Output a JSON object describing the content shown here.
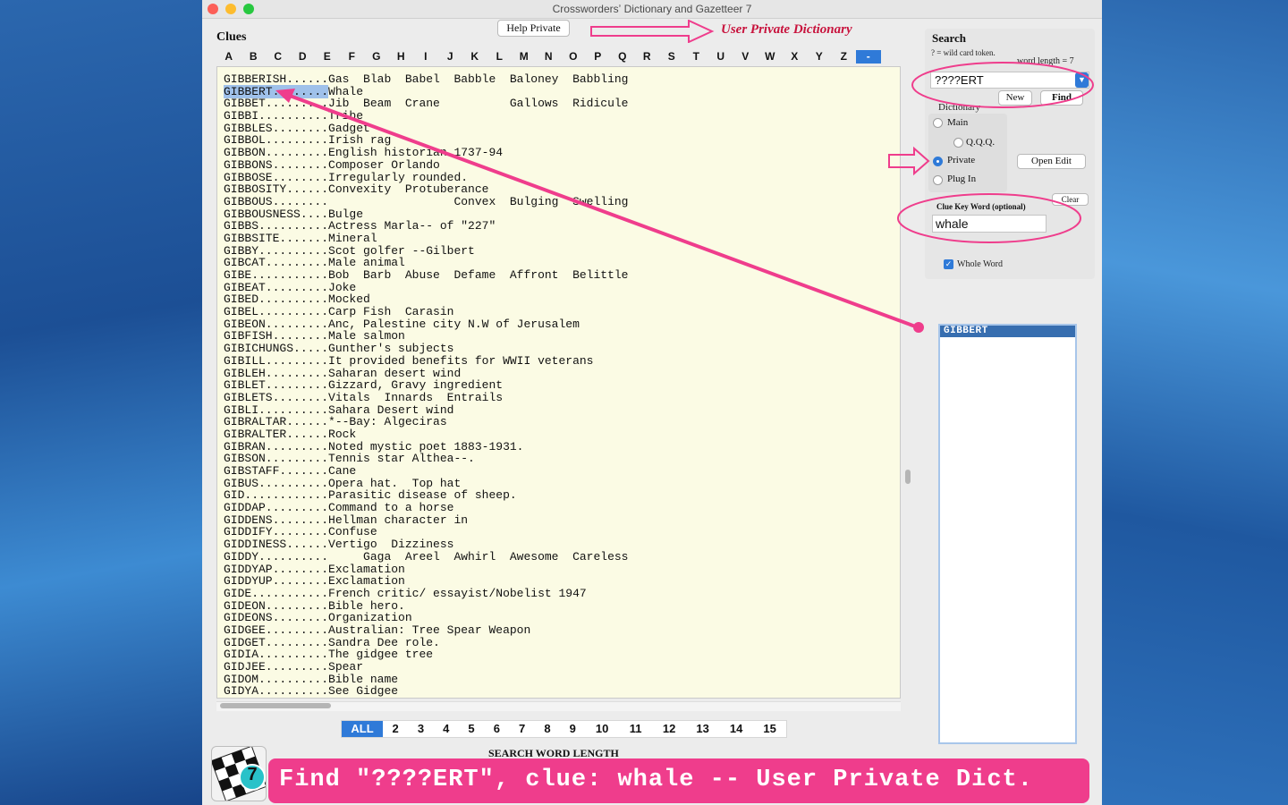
{
  "window": {
    "title": "Crosswordersʼ Dictionary and Gazetteer 7"
  },
  "clues_label": "Clues",
  "help_button": "Help Private",
  "annotation_title": "User Private Dictionary",
  "letters": [
    "A",
    "B",
    "C",
    "D",
    "E",
    "F",
    "G",
    "H",
    "I",
    "J",
    "K",
    "L",
    "M",
    "N",
    "O",
    "P",
    "Q",
    "R",
    "S",
    "T",
    "U",
    "V",
    "W",
    "X",
    "Y",
    "Z",
    "-"
  ],
  "active_letter": "-",
  "rows": [
    {
      "word": "GIBBERISH......",
      "clue": "Gas  Blab  Babel  Babble  Baloney  Babbling",
      "hl": false
    },
    {
      "word": "GIBBERT........",
      "clue": "Whale",
      "hl": true
    },
    {
      "word": "GIBBET.........",
      "clue": "Jib  Beam  Crane          Gallows  Ridicule",
      "hl": false
    },
    {
      "word": "GIBBI..........",
      "clue": "Tribe",
      "hl": false
    },
    {
      "word": "GIBBLES........",
      "clue": "Gadget",
      "hl": false
    },
    {
      "word": "GIBBOL.........",
      "clue": "Irish rag",
      "hl": false
    },
    {
      "word": "GIBBON.........",
      "clue": "English historian 1737-94",
      "hl": false
    },
    {
      "word": "GIBBONS........",
      "clue": "Composer Orlando",
      "hl": false
    },
    {
      "word": "GIBBOSE........",
      "clue": "Irregularly rounded.",
      "hl": false
    },
    {
      "word": "GIBBOSITY......",
      "clue": "Convexity  Protuberance",
      "hl": false
    },
    {
      "word": "GIBBOUS........",
      "clue": "                  Convex  Bulging  Swelling",
      "hl": false
    },
    {
      "word": "GIBBOUSNESS....",
      "clue": "Bulge",
      "hl": false
    },
    {
      "word": "GIBBS..........",
      "clue": "Actress Marla-- of \"227\"",
      "hl": false
    },
    {
      "word": "GIBBSITE.......",
      "clue": "Mineral",
      "hl": false
    },
    {
      "word": "GIBBY..........",
      "clue": "Scot golfer --Gilbert",
      "hl": false
    },
    {
      "word": "GIBCAT.........",
      "clue": "Male animal",
      "hl": false
    },
    {
      "word": "GIBE...........",
      "clue": "Bob  Barb  Abuse  Defame  Affront  Belittle",
      "hl": false
    },
    {
      "word": "GIBEAT.........",
      "clue": "Joke",
      "hl": false
    },
    {
      "word": "GIBED..........",
      "clue": "Mocked",
      "hl": false
    },
    {
      "word": "GIBEL..........",
      "clue": "Carp Fish  Carasin",
      "hl": false
    },
    {
      "word": "GIBEON.........",
      "clue": "Anc, Palestine city N.W of Jerusalem",
      "hl": false
    },
    {
      "word": "GIBFISH........",
      "clue": "Male salmon",
      "hl": false
    },
    {
      "word": "GIBICHUNGS.....",
      "clue": "Gunther's subjects",
      "hl": false
    },
    {
      "word": "GIBILL.........",
      "clue": "It provided benefits for WWII veterans",
      "hl": false
    },
    {
      "word": "GIBLEH.........",
      "clue": "Saharan desert wind",
      "hl": false
    },
    {
      "word": "GIBLET.........",
      "clue": "Gizzard, Gravy ingredient",
      "hl": false
    },
    {
      "word": "GIBLETS........",
      "clue": "Vitals  Innards  Entrails",
      "hl": false
    },
    {
      "word": "GIBLI..........",
      "clue": "Sahara Desert wind",
      "hl": false
    },
    {
      "word": "GIBRALTAR......",
      "clue": "*--Bay: Algeciras",
      "hl": false
    },
    {
      "word": "GIBRALTER......",
      "clue": "Rock",
      "hl": false
    },
    {
      "word": "GIBRAN.........",
      "clue": "Noted mystic poet 1883-1931.",
      "hl": false
    },
    {
      "word": "GIBSON.........",
      "clue": "Tennis star Althea--.",
      "hl": false
    },
    {
      "word": "GIBSTAFF.......",
      "clue": "Cane",
      "hl": false
    },
    {
      "word": "GIBUS..........",
      "clue": "Opera hat.  Top hat",
      "hl": false
    },
    {
      "word": "GID............",
      "clue": "Parasitic disease of sheep.",
      "hl": false
    },
    {
      "word": "GIDDAP.........",
      "clue": "Command to a horse",
      "hl": false
    },
    {
      "word": "GIDDENS........",
      "clue": "Hellman character in",
      "hl": false
    },
    {
      "word": "GIDDIFY........",
      "clue": "Confuse",
      "hl": false
    },
    {
      "word": "GIDDINESS......",
      "clue": "Vertigo  Dizziness",
      "hl": false
    },
    {
      "word": "GIDDY..........",
      "clue": "     Gaga  Areel  Awhirl  Awesome  Careless",
      "hl": false
    },
    {
      "word": "GIDDYAP........",
      "clue": "Exclamation",
      "hl": false
    },
    {
      "word": "GIDDYUP........",
      "clue": "Exclamation",
      "hl": false
    },
    {
      "word": "GIDE...........",
      "clue": "French critic/ essayist/Nobelist 1947",
      "hl": false
    },
    {
      "word": "GIDEON.........",
      "clue": "Bible hero.",
      "hl": false
    },
    {
      "word": "GIDEONS........",
      "clue": "Organization",
      "hl": false
    },
    {
      "word": "GIDGEE.........",
      "clue": "Australian: Tree Spear Weapon",
      "hl": false
    },
    {
      "word": "GIDGET.........",
      "clue": "Sandra Dee role.",
      "hl": false
    },
    {
      "word": "GIDIA..........",
      "clue": "The gidgee tree",
      "hl": false
    },
    {
      "word": "GIDJEE.........",
      "clue": "Spear",
      "hl": false
    },
    {
      "word": "GIDOM..........",
      "clue": "Bible name",
      "hl": false
    },
    {
      "word": "GIDYA..........",
      "clue": "See Gidgee",
      "hl": false
    }
  ],
  "lengths": [
    "ALL",
    "2",
    "3",
    "4",
    "5",
    "6",
    "7",
    "8",
    "9",
    "10",
    "11",
    "12",
    "13",
    "14",
    "15"
  ],
  "active_length": "ALL",
  "search_word_length_label": "SEARCH WORD LENGTH",
  "app_icon_number": "7",
  "banner": "Find \"????ERT\", clue: whale -- User Private Dict.",
  "search": {
    "title": "Search",
    "wildcard_note": "? = wild card token.",
    "word_length": "word length = 7",
    "query": "????ERT",
    "new_label": "New",
    "find_label": "Find",
    "dictionary_label": "Dictionary",
    "options": [
      {
        "label": "Main",
        "checked": false
      },
      {
        "label": "Q.Q.Q.",
        "checked": false
      },
      {
        "label": "Private",
        "checked": true
      },
      {
        "label": "Plug In",
        "checked": false
      }
    ],
    "open_edit_label": "Open Edit",
    "clear_label": "Clear",
    "clue_key_label": "Clue Key Word  (optional)",
    "clue_key_value": "whale",
    "whole_word_label": "Whole Word",
    "whole_word_checked": true
  },
  "results": [
    "GIBBERT"
  ],
  "colors": {
    "accent": "#2f7ad8",
    "annotation": "#ef3d8c",
    "highlight": "#9fc1ea",
    "clue_bg": "#fbfbe4"
  }
}
